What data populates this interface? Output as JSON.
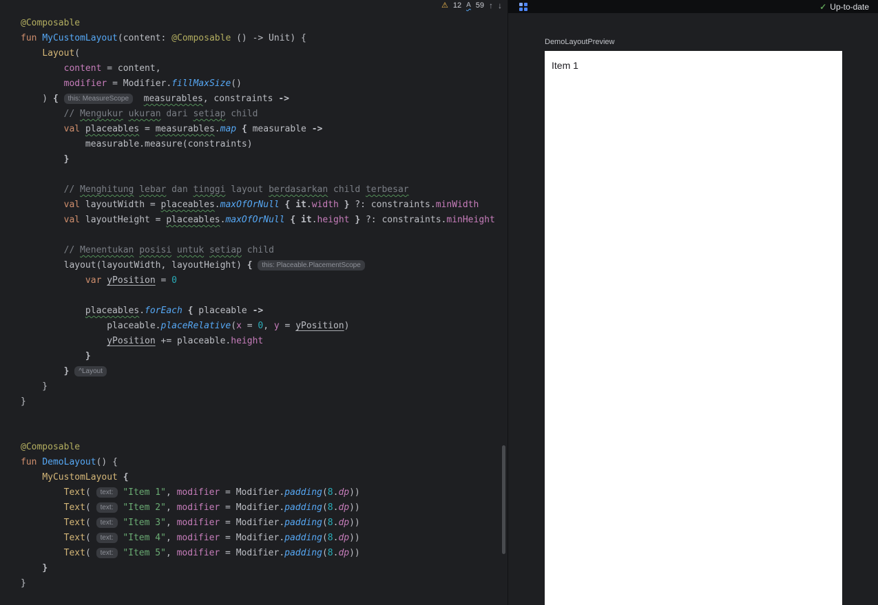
{
  "colors": {
    "editor_bg": "#1E1F22",
    "toolbar_bg": "#0D0E10",
    "accent_blue": "#3574F0",
    "status_green": "#5C9E54",
    "warning_yellow": "#F5BD4F",
    "preview_surface": "#FFFFFF"
  },
  "editor": {
    "inspections": {
      "warnings": "12",
      "typos": "59"
    },
    "lines": [
      [
        [
          "ann",
          "@Composable"
        ]
      ],
      [
        [
          "k",
          "fun "
        ],
        [
          "fnd",
          "MyCustomLayout"
        ],
        [
          "p",
          "(content: "
        ],
        [
          "ann",
          "@Composable"
        ],
        [
          "p",
          " () -> Unit) {"
        ]
      ],
      [
        [
          "p",
          "    "
        ],
        [
          "fnc",
          "Layout"
        ],
        [
          "p",
          "("
        ]
      ],
      [
        [
          "p",
          "        "
        ],
        [
          "named",
          "content"
        ],
        [
          "p",
          " = content,"
        ]
      ],
      [
        [
          "p",
          "        "
        ],
        [
          "named",
          "modifier"
        ],
        [
          "p",
          " = Modifier."
        ],
        [
          "ext",
          "fillMaxSize"
        ],
        [
          "p",
          "()"
        ]
      ],
      [
        [
          "p",
          "    ) "
        ],
        [
          "b",
          "{"
        ],
        [
          "p",
          " "
        ],
        [
          "chip",
          "this: MeasureScope"
        ],
        [
          "p",
          "  "
        ],
        [
          "typo",
          "measurables"
        ],
        [
          "p",
          ", constraints "
        ],
        [
          "b",
          "->"
        ]
      ],
      [
        [
          "p",
          "        "
        ],
        [
          "cmt",
          "// "
        ],
        [
          "cmtw",
          "Mengukur"
        ],
        [
          "cmt",
          " "
        ],
        [
          "cmtw",
          "ukuran"
        ],
        [
          "cmt",
          " dari "
        ],
        [
          "cmtw",
          "setiap"
        ],
        [
          "cmt",
          " child"
        ]
      ],
      [
        [
          "p",
          "        "
        ],
        [
          "k",
          "val"
        ],
        [
          "p",
          " "
        ],
        [
          "typo",
          "placeables"
        ],
        [
          "p",
          " = "
        ],
        [
          "typo",
          "measurables"
        ],
        [
          "p",
          "."
        ],
        [
          "ext",
          "map"
        ],
        [
          "p",
          " "
        ],
        [
          "b",
          "{"
        ],
        [
          "p",
          " measurable "
        ],
        [
          "b",
          "->"
        ]
      ],
      [
        [
          "p",
          "            measurable.measure(constraints)"
        ]
      ],
      [
        [
          "p",
          "        "
        ],
        [
          "b",
          "}"
        ]
      ],
      [],
      [
        [
          "p",
          "        "
        ],
        [
          "cmt",
          "// "
        ],
        [
          "cmtw",
          "Menghitung"
        ],
        [
          "cmt",
          " "
        ],
        [
          "cmtw",
          "lebar"
        ],
        [
          "cmt",
          " dan "
        ],
        [
          "cmtw",
          "tinggi"
        ],
        [
          "cmt",
          " layout "
        ],
        [
          "cmtw",
          "berdasarkan"
        ],
        [
          "cmt",
          " child "
        ],
        [
          "cmtw",
          "terbesar"
        ]
      ],
      [
        [
          "p",
          "        "
        ],
        [
          "k",
          "val"
        ],
        [
          "p",
          " layoutWidth = "
        ],
        [
          "typo",
          "placeables"
        ],
        [
          "p",
          "."
        ],
        [
          "ext",
          "maxOfOrNull"
        ],
        [
          "p",
          " "
        ],
        [
          "b",
          "{"
        ],
        [
          "p",
          " "
        ],
        [
          "b",
          "it"
        ],
        [
          "p",
          "."
        ],
        [
          "prop",
          "width"
        ],
        [
          "p",
          " "
        ],
        [
          "b",
          "}"
        ],
        [
          "p",
          " ?: constraints."
        ],
        [
          "prop",
          "minWidth"
        ]
      ],
      [
        [
          "p",
          "        "
        ],
        [
          "k",
          "val"
        ],
        [
          "p",
          " layoutHeight = "
        ],
        [
          "typo",
          "placeables"
        ],
        [
          "p",
          "."
        ],
        [
          "ext",
          "maxOfOrNull"
        ],
        [
          "p",
          " "
        ],
        [
          "b",
          "{"
        ],
        [
          "p",
          " "
        ],
        [
          "b",
          "it"
        ],
        [
          "p",
          "."
        ],
        [
          "prop",
          "height"
        ],
        [
          "p",
          " "
        ],
        [
          "b",
          "}"
        ],
        [
          "p",
          " ?: constraints."
        ],
        [
          "prop",
          "minHeight"
        ]
      ],
      [],
      [
        [
          "p",
          "        "
        ],
        [
          "cmt",
          "// "
        ],
        [
          "cmtw",
          "Menentukan"
        ],
        [
          "cmt",
          " "
        ],
        [
          "cmtw",
          "posisi"
        ],
        [
          "cmt",
          " "
        ],
        [
          "cmtw",
          "untuk"
        ],
        [
          "cmt",
          " "
        ],
        [
          "cmtw",
          "setiap"
        ],
        [
          "cmt",
          " child"
        ]
      ],
      [
        [
          "p",
          "        layout(layoutWidth, layoutHeight) "
        ],
        [
          "b",
          "{"
        ],
        [
          "p",
          " "
        ],
        [
          "chip",
          "this: Placeable.PlacementScope"
        ]
      ],
      [
        [
          "p",
          "            "
        ],
        [
          "k",
          "var"
        ],
        [
          "p",
          " "
        ],
        [
          "var",
          "yPosition"
        ],
        [
          "p",
          " = "
        ],
        [
          "num",
          "0"
        ]
      ],
      [],
      [
        [
          "p",
          "            "
        ],
        [
          "typo",
          "placeables"
        ],
        [
          "p",
          "."
        ],
        [
          "ext",
          "forEach"
        ],
        [
          "p",
          " "
        ],
        [
          "b",
          "{"
        ],
        [
          "p",
          " placeable "
        ],
        [
          "b",
          "->"
        ]
      ],
      [
        [
          "p",
          "                placeable."
        ],
        [
          "ext",
          "placeRelative"
        ],
        [
          "p",
          "("
        ],
        [
          "named",
          "x"
        ],
        [
          "p",
          " = "
        ],
        [
          "num",
          "0"
        ],
        [
          "p",
          ", "
        ],
        [
          "named",
          "y"
        ],
        [
          "p",
          " = "
        ],
        [
          "var",
          "yPosition"
        ],
        [
          "p",
          ")"
        ]
      ],
      [
        [
          "p",
          "                "
        ],
        [
          "var",
          "yPosition"
        ],
        [
          "p",
          " += placeable."
        ],
        [
          "prop",
          "height"
        ]
      ],
      [
        [
          "p",
          "            "
        ],
        [
          "b",
          "}"
        ]
      ],
      [
        [
          "p",
          "        "
        ],
        [
          "b",
          "}"
        ],
        [
          "p",
          " "
        ],
        [
          "chip",
          "^Layout"
        ]
      ],
      [
        [
          "p",
          "    }"
        ]
      ],
      [
        [
          "p",
          "}"
        ]
      ],
      [],
      [],
      [
        [
          "ann",
          "@Composable"
        ]
      ],
      [
        [
          "k",
          "fun "
        ],
        [
          "fnd",
          "DemoLayout"
        ],
        [
          "p",
          "() {"
        ]
      ],
      [
        [
          "p",
          "    "
        ],
        [
          "fnc",
          "MyCustomLayout"
        ],
        [
          "p",
          " "
        ],
        [
          "b",
          "{"
        ]
      ],
      [
        [
          "p",
          "        "
        ],
        [
          "fnc",
          "Text"
        ],
        [
          "p",
          "( "
        ],
        [
          "chip",
          "text:"
        ],
        [
          "p",
          " "
        ],
        [
          "str",
          "\"Item 1\""
        ],
        [
          "p",
          ", "
        ],
        [
          "named",
          "modifier"
        ],
        [
          "p",
          " = Modifier."
        ],
        [
          "ext",
          "padding"
        ],
        [
          "p",
          "("
        ],
        [
          "num",
          "8"
        ],
        [
          "p",
          "."
        ],
        [
          "eprop",
          "dp"
        ],
        [
          "p",
          "))"
        ]
      ],
      [
        [
          "p",
          "        "
        ],
        [
          "fnc",
          "Text"
        ],
        [
          "p",
          "( "
        ],
        [
          "chip",
          "text:"
        ],
        [
          "p",
          " "
        ],
        [
          "str",
          "\"Item 2\""
        ],
        [
          "p",
          ", "
        ],
        [
          "named",
          "modifier"
        ],
        [
          "p",
          " = Modifier."
        ],
        [
          "ext",
          "padding"
        ],
        [
          "p",
          "("
        ],
        [
          "num",
          "8"
        ],
        [
          "p",
          "."
        ],
        [
          "eprop",
          "dp"
        ],
        [
          "p",
          "))"
        ]
      ],
      [
        [
          "p",
          "        "
        ],
        [
          "fnc",
          "Text"
        ],
        [
          "p",
          "( "
        ],
        [
          "chip",
          "text:"
        ],
        [
          "p",
          " "
        ],
        [
          "str",
          "\"Item 3\""
        ],
        [
          "p",
          ", "
        ],
        [
          "named",
          "modifier"
        ],
        [
          "p",
          " = Modifier."
        ],
        [
          "ext",
          "padding"
        ],
        [
          "p",
          "("
        ],
        [
          "num",
          "8"
        ],
        [
          "p",
          "."
        ],
        [
          "eprop",
          "dp"
        ],
        [
          "p",
          "))"
        ]
      ],
      [
        [
          "p",
          "        "
        ],
        [
          "fnc",
          "Text"
        ],
        [
          "p",
          "( "
        ],
        [
          "chip",
          "text:"
        ],
        [
          "p",
          " "
        ],
        [
          "str",
          "\"Item 4\""
        ],
        [
          "p",
          ", "
        ],
        [
          "named",
          "modifier"
        ],
        [
          "p",
          " = Modifier."
        ],
        [
          "ext",
          "padding"
        ],
        [
          "p",
          "("
        ],
        [
          "num",
          "8"
        ],
        [
          "p",
          "."
        ],
        [
          "eprop",
          "dp"
        ],
        [
          "p",
          "))"
        ]
      ],
      [
        [
          "p",
          "        "
        ],
        [
          "fnc",
          "Text"
        ],
        [
          "p",
          "( "
        ],
        [
          "chip",
          "text:"
        ],
        [
          "p",
          " "
        ],
        [
          "str",
          "\"Item 5\""
        ],
        [
          "p",
          ", "
        ],
        [
          "named",
          "modifier"
        ],
        [
          "p",
          " = Modifier."
        ],
        [
          "ext",
          "padding"
        ],
        [
          "p",
          "("
        ],
        [
          "num",
          "8"
        ],
        [
          "p",
          "."
        ],
        [
          "eprop",
          "dp"
        ],
        [
          "p",
          "))"
        ]
      ],
      [
        [
          "p",
          "    "
        ],
        [
          "b",
          "}"
        ]
      ],
      [
        [
          "p",
          "}"
        ]
      ]
    ]
  },
  "preview": {
    "toolbar": {
      "status": "Up-to-date"
    },
    "label": "DemoLayoutPreview",
    "content_text": "Item 1"
  }
}
